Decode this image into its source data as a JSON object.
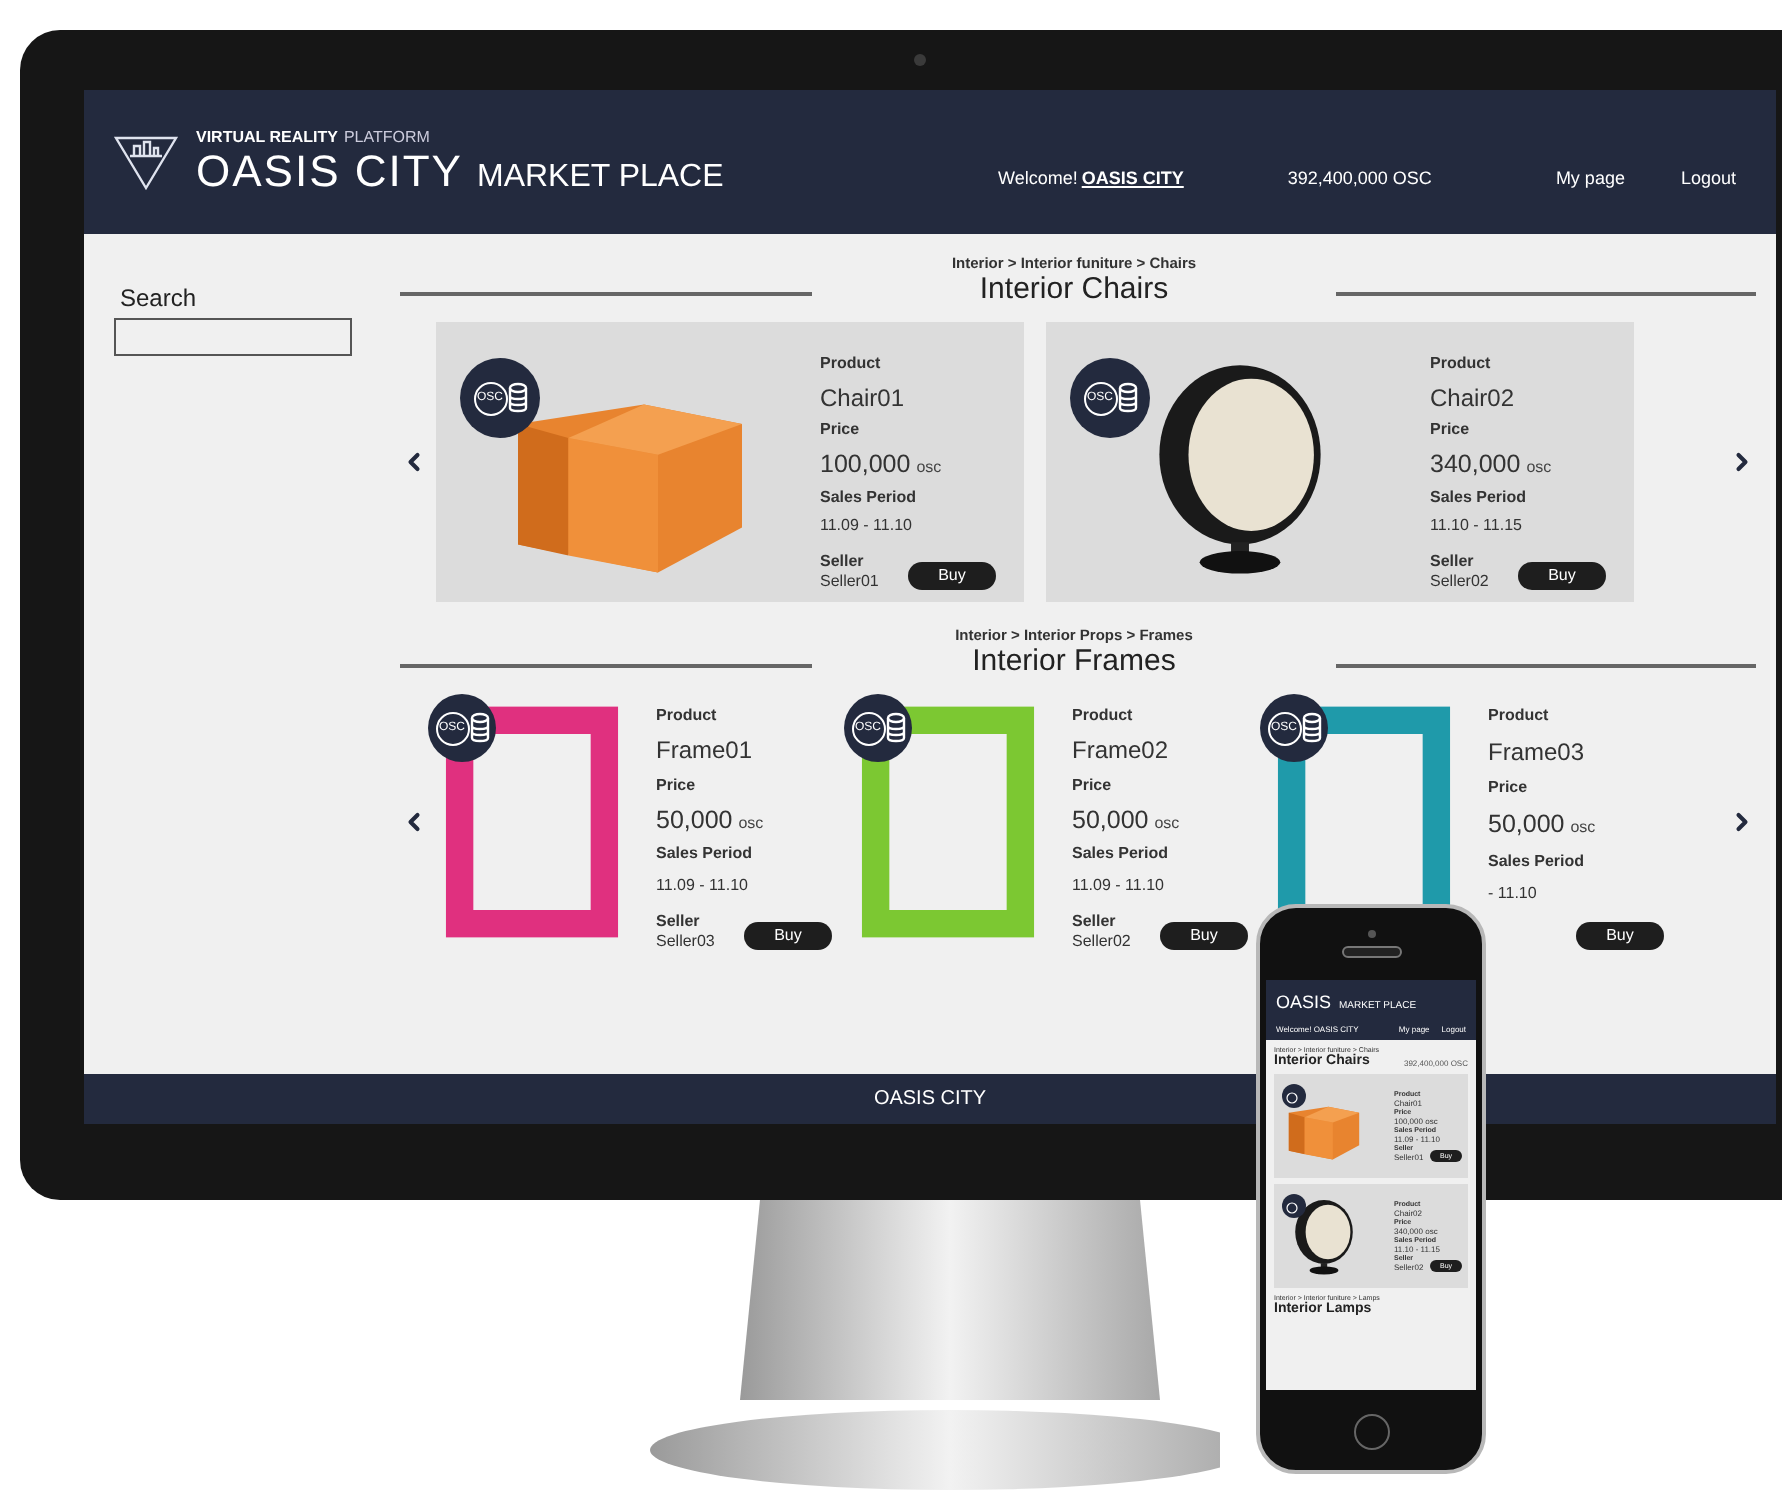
{
  "header": {
    "tagline_bold": "VIRTUAL REALITY",
    "tagline": "PLATFORM",
    "brand": "OASIS CITY",
    "subtitle": "MARKET PLACE",
    "welcome": "Welcome!",
    "user": "OASIS CITY",
    "balance": "392,400,000 OSC",
    "nav": [
      "My page",
      "Logout"
    ]
  },
  "search": {
    "label": "Search"
  },
  "sections": [
    {
      "kind": "boxed",
      "breadcrumb": "Interior > Interior funiture > Chairs",
      "title": "Interior Chairs",
      "products": [
        {
          "kind": "armchair",
          "badge": "OSC",
          "product_label": "Product",
          "name": "Chair01",
          "price_label": "Price",
          "price": "100,000",
          "unit": "osc",
          "period_label": "Sales Period",
          "period": "11.09 - 11.10",
          "seller_label": "Seller",
          "seller": "Seller01",
          "buy": "Buy"
        },
        {
          "kind": "ball-chair",
          "badge": "OSC",
          "product_label": "Product",
          "name": "Chair02",
          "price_label": "Price",
          "price": "340,000",
          "unit": "osc",
          "period_label": "Sales Period",
          "period": "11.10 - 11.15",
          "seller_label": "Seller",
          "seller": "Seller02",
          "buy": "Buy"
        }
      ]
    },
    {
      "kind": "open",
      "breadcrumb": "Interior > Interior Props > Frames",
      "title": "Interior Frames",
      "products": [
        {
          "kind": "frame",
          "color": "#e0307f",
          "badge": "OSC",
          "product_label": "Product",
          "name": "Frame01",
          "price_label": "Price",
          "price": "50,000",
          "unit": "osc",
          "period_label": "Sales Period",
          "period": "11.09 - 11.10",
          "seller_label": "Seller",
          "seller": "Seller03",
          "buy": "Buy"
        },
        {
          "kind": "frame",
          "color": "#7cc832",
          "badge": "OSC",
          "product_label": "Product",
          "name": "Frame02",
          "price_label": "Price",
          "price": "50,000",
          "unit": "osc",
          "period_label": "Sales Period",
          "period": "11.09 - 11.10",
          "seller_label": "Seller",
          "seller": "Seller02",
          "buy": "Buy"
        },
        {
          "kind": "frame",
          "color": "#1f9aaa",
          "badge": "OSC",
          "product_label": "Product",
          "name": "Frame03",
          "price_label": "Price",
          "price": "50,000",
          "unit": "osc",
          "period_label": "Sales Period",
          "period": "- 11.10",
          "buy": "Buy"
        }
      ]
    }
  ],
  "footer": "OASIS CITY",
  "phone": {
    "brand": "OASIS",
    "subtitle": "MARKET PLACE",
    "welcome": "Welcome! OASIS CITY",
    "nav": [
      "My page",
      "Logout"
    ],
    "breadcrumb": "Interior > Interior funiture > Chairs",
    "title": "Interior Chairs",
    "balance": "392,400,000 OSC",
    "products": [
      {
        "kind": "armchair",
        "product_label": "Product",
        "name": "Chair01",
        "price_label": "Price",
        "price": "100,000",
        "unit": "osc",
        "period_label": "Sales Period",
        "period": "11.09 - 11.10",
        "seller_label": "Seller",
        "seller": "Seller01",
        "buy": "Buy"
      },
      {
        "kind": "ball-chair",
        "product_label": "Product",
        "name": "Chair02",
        "price_label": "Price",
        "price": "340,000",
        "unit": "osc",
        "period_label": "Sales Period",
        "period": "11.10 - 11.15",
        "seller_label": "Seller",
        "seller": "Seller02",
        "buy": "Buy"
      }
    ],
    "next_breadcrumb": "Interior > Interior funiture > Lamps",
    "next_title": "Interior Lamps"
  }
}
